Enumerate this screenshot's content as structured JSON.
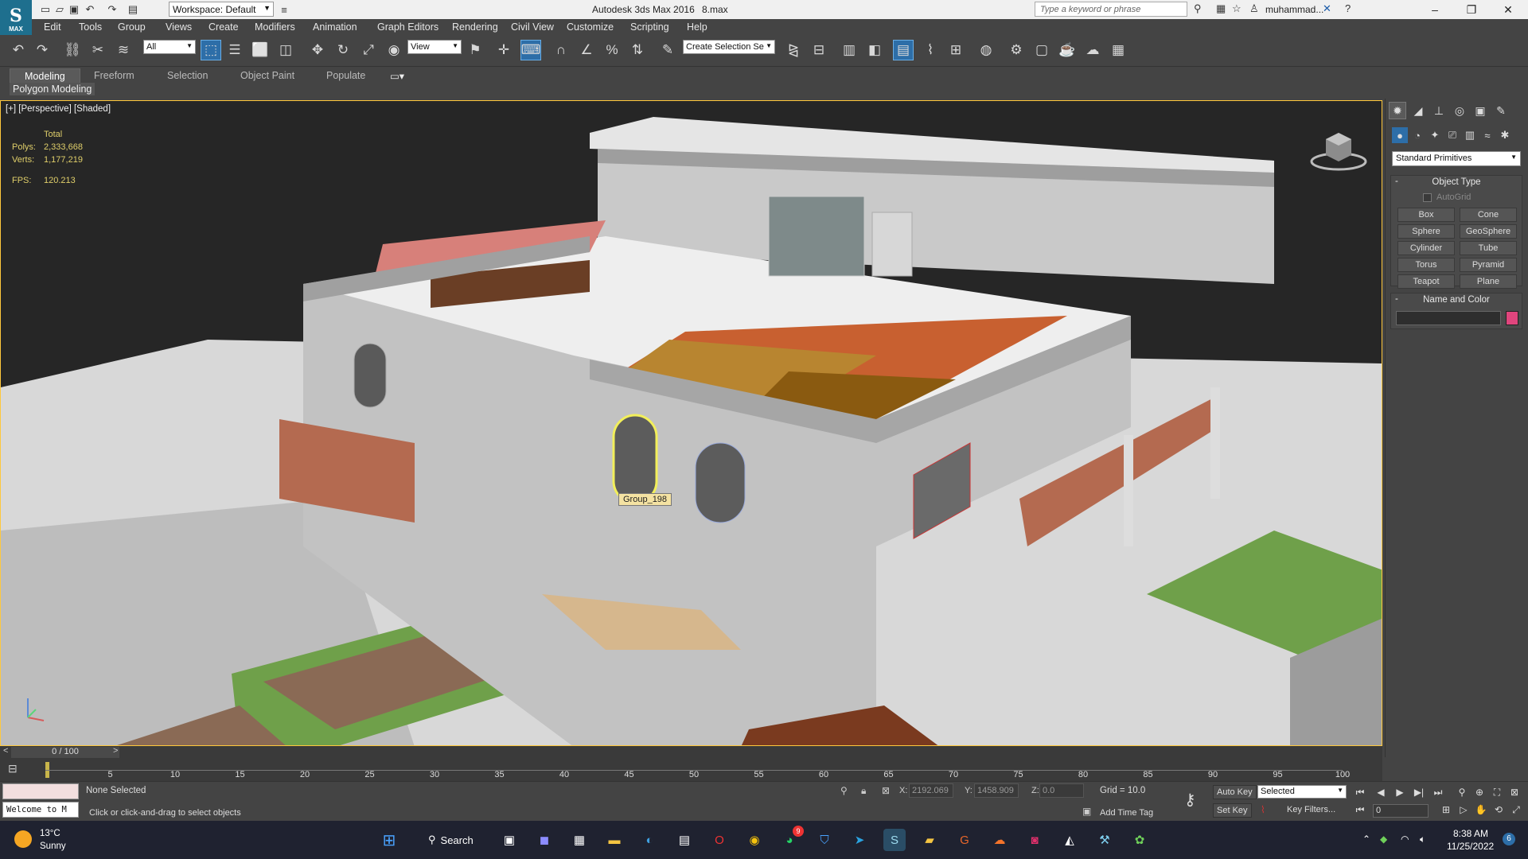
{
  "titlebar": {
    "logo_text": "MAX",
    "workspace": "Workspace: Default",
    "app_title": "Autodesk 3ds Max 2016",
    "file_name": "8.max",
    "search_placeholder": "Type a keyword or phrase",
    "user": "muhammad..."
  },
  "menubar": [
    "Edit",
    "Tools",
    "Group",
    "Views",
    "Create",
    "Modifiers",
    "Animation",
    "Graph Editors",
    "Rendering",
    "Civil View",
    "Customize",
    "Scripting",
    "Help"
  ],
  "toolbar": {
    "selection_filter": "All",
    "ref_coord": "View",
    "named_selection": "Create Selection Se"
  },
  "ribbon": {
    "tabs": [
      "Modeling",
      "Freeform",
      "Selection",
      "Object Paint",
      "Populate"
    ],
    "panel_label": "Polygon Modeling"
  },
  "viewport": {
    "label": "[+] [Perspective] [Shaded]",
    "stats_header": "Total",
    "polys_label": "Polys:",
    "polys_value": "2,333,668",
    "verts_label": "Verts:",
    "verts_value": "1,177,219",
    "fps_label": "FPS:",
    "fps_value": "120.213",
    "tooltip": "Group_198"
  },
  "command_panel": {
    "category": "Standard Primitives",
    "object_type_title": "Object Type",
    "autogrid": "AutoGrid",
    "primitives": [
      "Box",
      "Cone",
      "Sphere",
      "GeoSphere",
      "Cylinder",
      "Tube",
      "Torus",
      "Pyramid",
      "Teapot",
      "Plane"
    ],
    "name_color_title": "Name and Color",
    "swatch_color": "#e0457d"
  },
  "timeline": {
    "frame_readout": "0 / 100",
    "ticks": [
      "5",
      "10",
      "15",
      "20",
      "25",
      "30",
      "35",
      "40",
      "45",
      "50",
      "55",
      "60",
      "65",
      "70",
      "75",
      "80",
      "85",
      "90",
      "95",
      "100"
    ]
  },
  "status": {
    "welcome": "Welcome to M",
    "selection": "None Selected",
    "prompt": "Click or click-and-drag to select objects",
    "x_label": "X:",
    "x_value": "2192.069",
    "y_label": "Y:",
    "y_value": "1458.909",
    "z_label": "Z:",
    "z_value": "0.0",
    "grid": "Grid = 10.0",
    "add_time_tag": "Add Time Tag",
    "auto_key": "Auto Key",
    "set_key": "Set Key",
    "key_mode": "Selected",
    "key_filters": "Key Filters...",
    "current_frame": "0"
  },
  "taskbar": {
    "temperature": "13°C",
    "condition": "Sunny",
    "search_label": "Search",
    "whatsapp_badge": "9",
    "time": "8:38 AM",
    "date": "11/25/2022",
    "notifications": "6"
  }
}
